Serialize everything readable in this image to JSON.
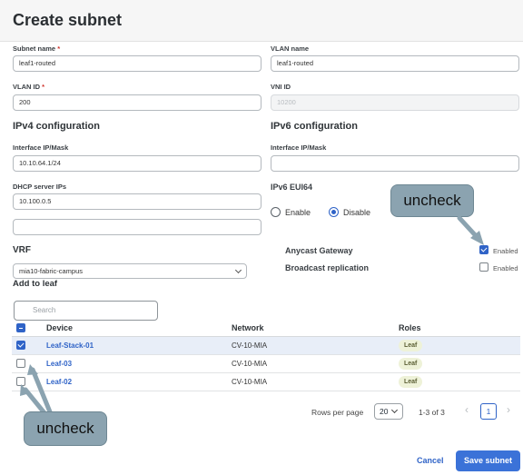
{
  "modal": {
    "title": "Create subnet"
  },
  "fields": {
    "subnet_name": {
      "label": "Subnet name",
      "required_mark": "*",
      "value": "leaf1-routed"
    },
    "vlan_name": {
      "label": "VLAN name",
      "value": "leaf1-routed"
    },
    "vlan_id": {
      "label": "VLAN ID",
      "required_mark": "*",
      "value": "200"
    },
    "vni_id": {
      "label": "VNI ID",
      "value": "10200"
    }
  },
  "ipv4": {
    "title": "IPv4 configuration",
    "interface_label": "Interface IP/Mask",
    "interface_value": "10.10.64.1/24",
    "dhcp_label": "DHCP server IPs",
    "dhcp_values": [
      "10.100.0.5",
      ""
    ]
  },
  "ipv6": {
    "title": "IPv6 configuration",
    "interface_label": "Interface IP/Mask",
    "interface_value": "",
    "eui64_label": "IPv6 EUI64",
    "options": [
      "Enable",
      "Disable"
    ],
    "selected": "Disable"
  },
  "toggles": {
    "anycast": {
      "label": "Anycast Gateway",
      "state_text": "Enabled",
      "checked": true
    },
    "broadcast": {
      "label": "Broadcast replication",
      "state_text": "Enabled",
      "checked": false
    }
  },
  "vrf": {
    "label": "VRF",
    "value": "mia10-fabric-campus"
  },
  "add_to_leaf": {
    "label": "Add to leaf",
    "search_placeholder": "Search",
    "columns": [
      "Device",
      "Network",
      "Roles"
    ],
    "rows": [
      {
        "device": "Leaf-Stack-01",
        "network": "CV-10-MIA",
        "role": "Leaf",
        "checked": true
      },
      {
        "device": "Leaf-03",
        "network": "CV-10-MIA",
        "role": "Leaf",
        "checked": false
      },
      {
        "device": "Leaf-02",
        "network": "CV-10-MIA",
        "role": "Leaf",
        "checked": false
      }
    ]
  },
  "pagination": {
    "rows_per_page_label": "Rows per page",
    "rows_per_page": "20",
    "range": "1-3 of 3",
    "prev_icon": "‹",
    "next_icon": "›",
    "current_page": "1"
  },
  "footer": {
    "cancel": "Cancel",
    "submit": "Save subnet"
  },
  "annotations": {
    "top": "uncheck",
    "bottom": "uncheck"
  },
  "colors": {
    "accent": "#3b72d8",
    "callout": "#8ba3b0",
    "selected_row": "#e8eef8"
  }
}
